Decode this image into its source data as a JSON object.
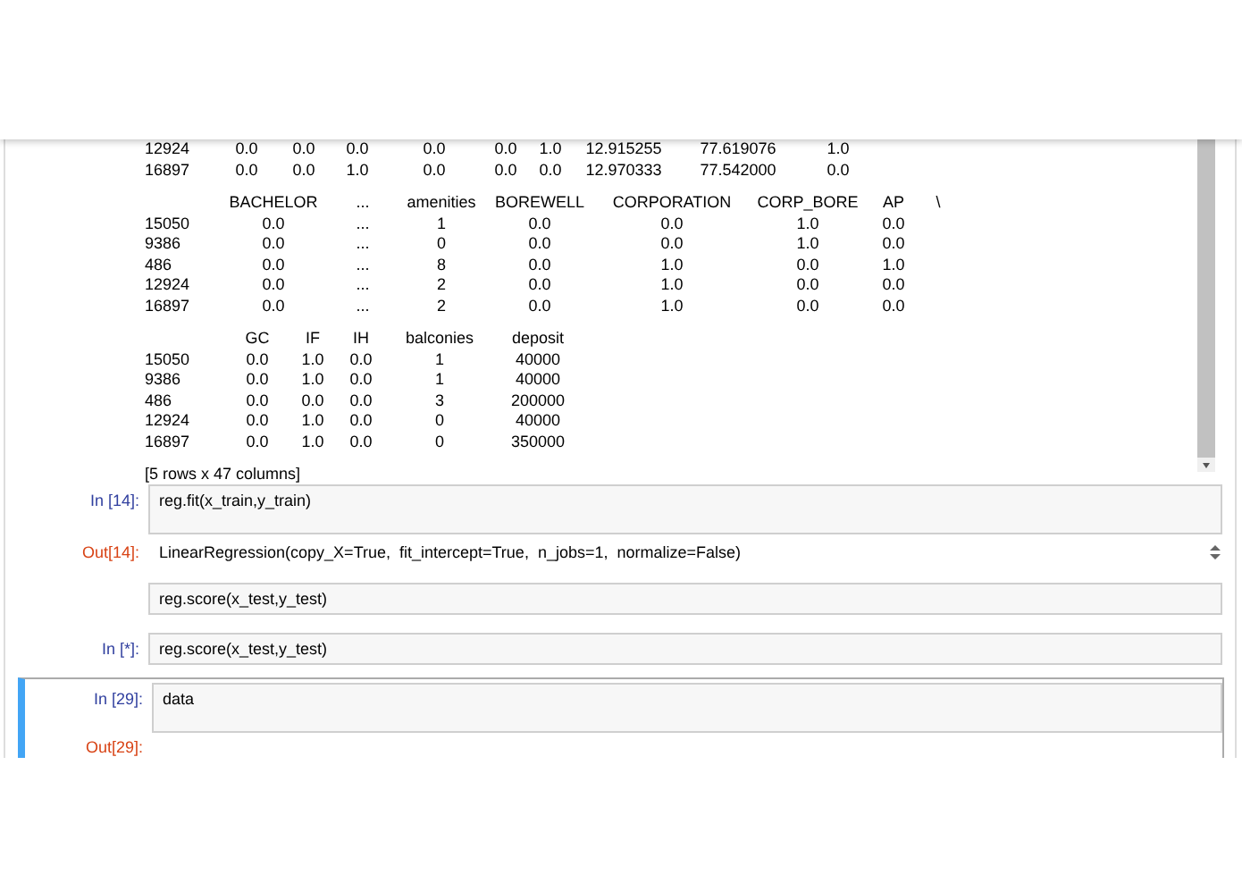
{
  "output_cell": {
    "tables": [
      {
        "rows": [
          {
            "index": "12924",
            "cells": [
              "0.0",
              "0.0",
              "0.0",
              "0.0",
              "0.0",
              "1.0",
              "12.915255",
              "77.619076",
              "1.0"
            ]
          },
          {
            "index": "16897",
            "cells": [
              "0.0",
              "0.0",
              "1.0",
              "0.0",
              "0.0",
              "0.0",
              "12.970333",
              "77.542000",
              "0.0"
            ]
          }
        ]
      },
      {
        "columns": [
          "BACHELOR",
          "...",
          "amenities",
          "BOREWELL",
          "CORPORATION",
          "CORP_BORE",
          "AP",
          "\\"
        ],
        "rows": [
          {
            "index": "15050",
            "cells": [
              "0.0",
              "...",
              "1",
              "0.0",
              "0.0",
              "1.0",
              "0.0",
              ""
            ]
          },
          {
            "index": "9386",
            "cells": [
              "0.0",
              "...",
              "0",
              "0.0",
              "0.0",
              "1.0",
              "0.0",
              ""
            ]
          },
          {
            "index": "486",
            "cells": [
              "0.0",
              "...",
              "8",
              "0.0",
              "1.0",
              "0.0",
              "1.0",
              ""
            ]
          },
          {
            "index": "12924",
            "cells": [
              "0.0",
              "...",
              "2",
              "0.0",
              "1.0",
              "0.0",
              "0.0",
              ""
            ]
          },
          {
            "index": "16897",
            "cells": [
              "0.0",
              "...",
              "2",
              "0.0",
              "1.0",
              "0.0",
              "0.0",
              ""
            ]
          }
        ]
      },
      {
        "columns": [
          "GC",
          "IF",
          "IH",
          "balconies",
          "deposit"
        ],
        "rows": [
          {
            "index": "15050",
            "cells": [
              "0.0",
              "1.0",
              "0.0",
              "1",
              "40000"
            ]
          },
          {
            "index": "9386",
            "cells": [
              "0.0",
              "1.0",
              "0.0",
              "1",
              "40000"
            ]
          },
          {
            "index": "486",
            "cells": [
              "0.0",
              "0.0",
              "0.0",
              "3",
              "200000"
            ]
          },
          {
            "index": "12924",
            "cells": [
              "0.0",
              "1.0",
              "0.0",
              "0",
              "40000"
            ]
          },
          {
            "index": "16897",
            "cells": [
              "0.0",
              "1.0",
              "0.0",
              "0",
              "350000"
            ]
          }
        ]
      }
    ],
    "summary": "[5  rows  x  47  columns]"
  },
  "cells": [
    {
      "prompt": "In [14]:",
      "code": "reg.fit(x_train,y_train)",
      "selected": false,
      "tall": true,
      "output_prompt": "Out[14]:",
      "output": "LinearRegression(copy_X=True,  fit_intercept=True,  n_jobs=1,  normalize=False)"
    },
    {
      "code": "reg.score(x_test,y_test)",
      "selected": false,
      "tall": false
    },
    {
      "prompt": "In [*]:",
      "code": "reg.score(x_test,y_test)",
      "selected": false,
      "tall": false
    },
    {
      "prompt": "In [29]:",
      "code": "data",
      "selected": true,
      "tall": true,
      "output_prompt": "Out[29]:"
    }
  ]
}
